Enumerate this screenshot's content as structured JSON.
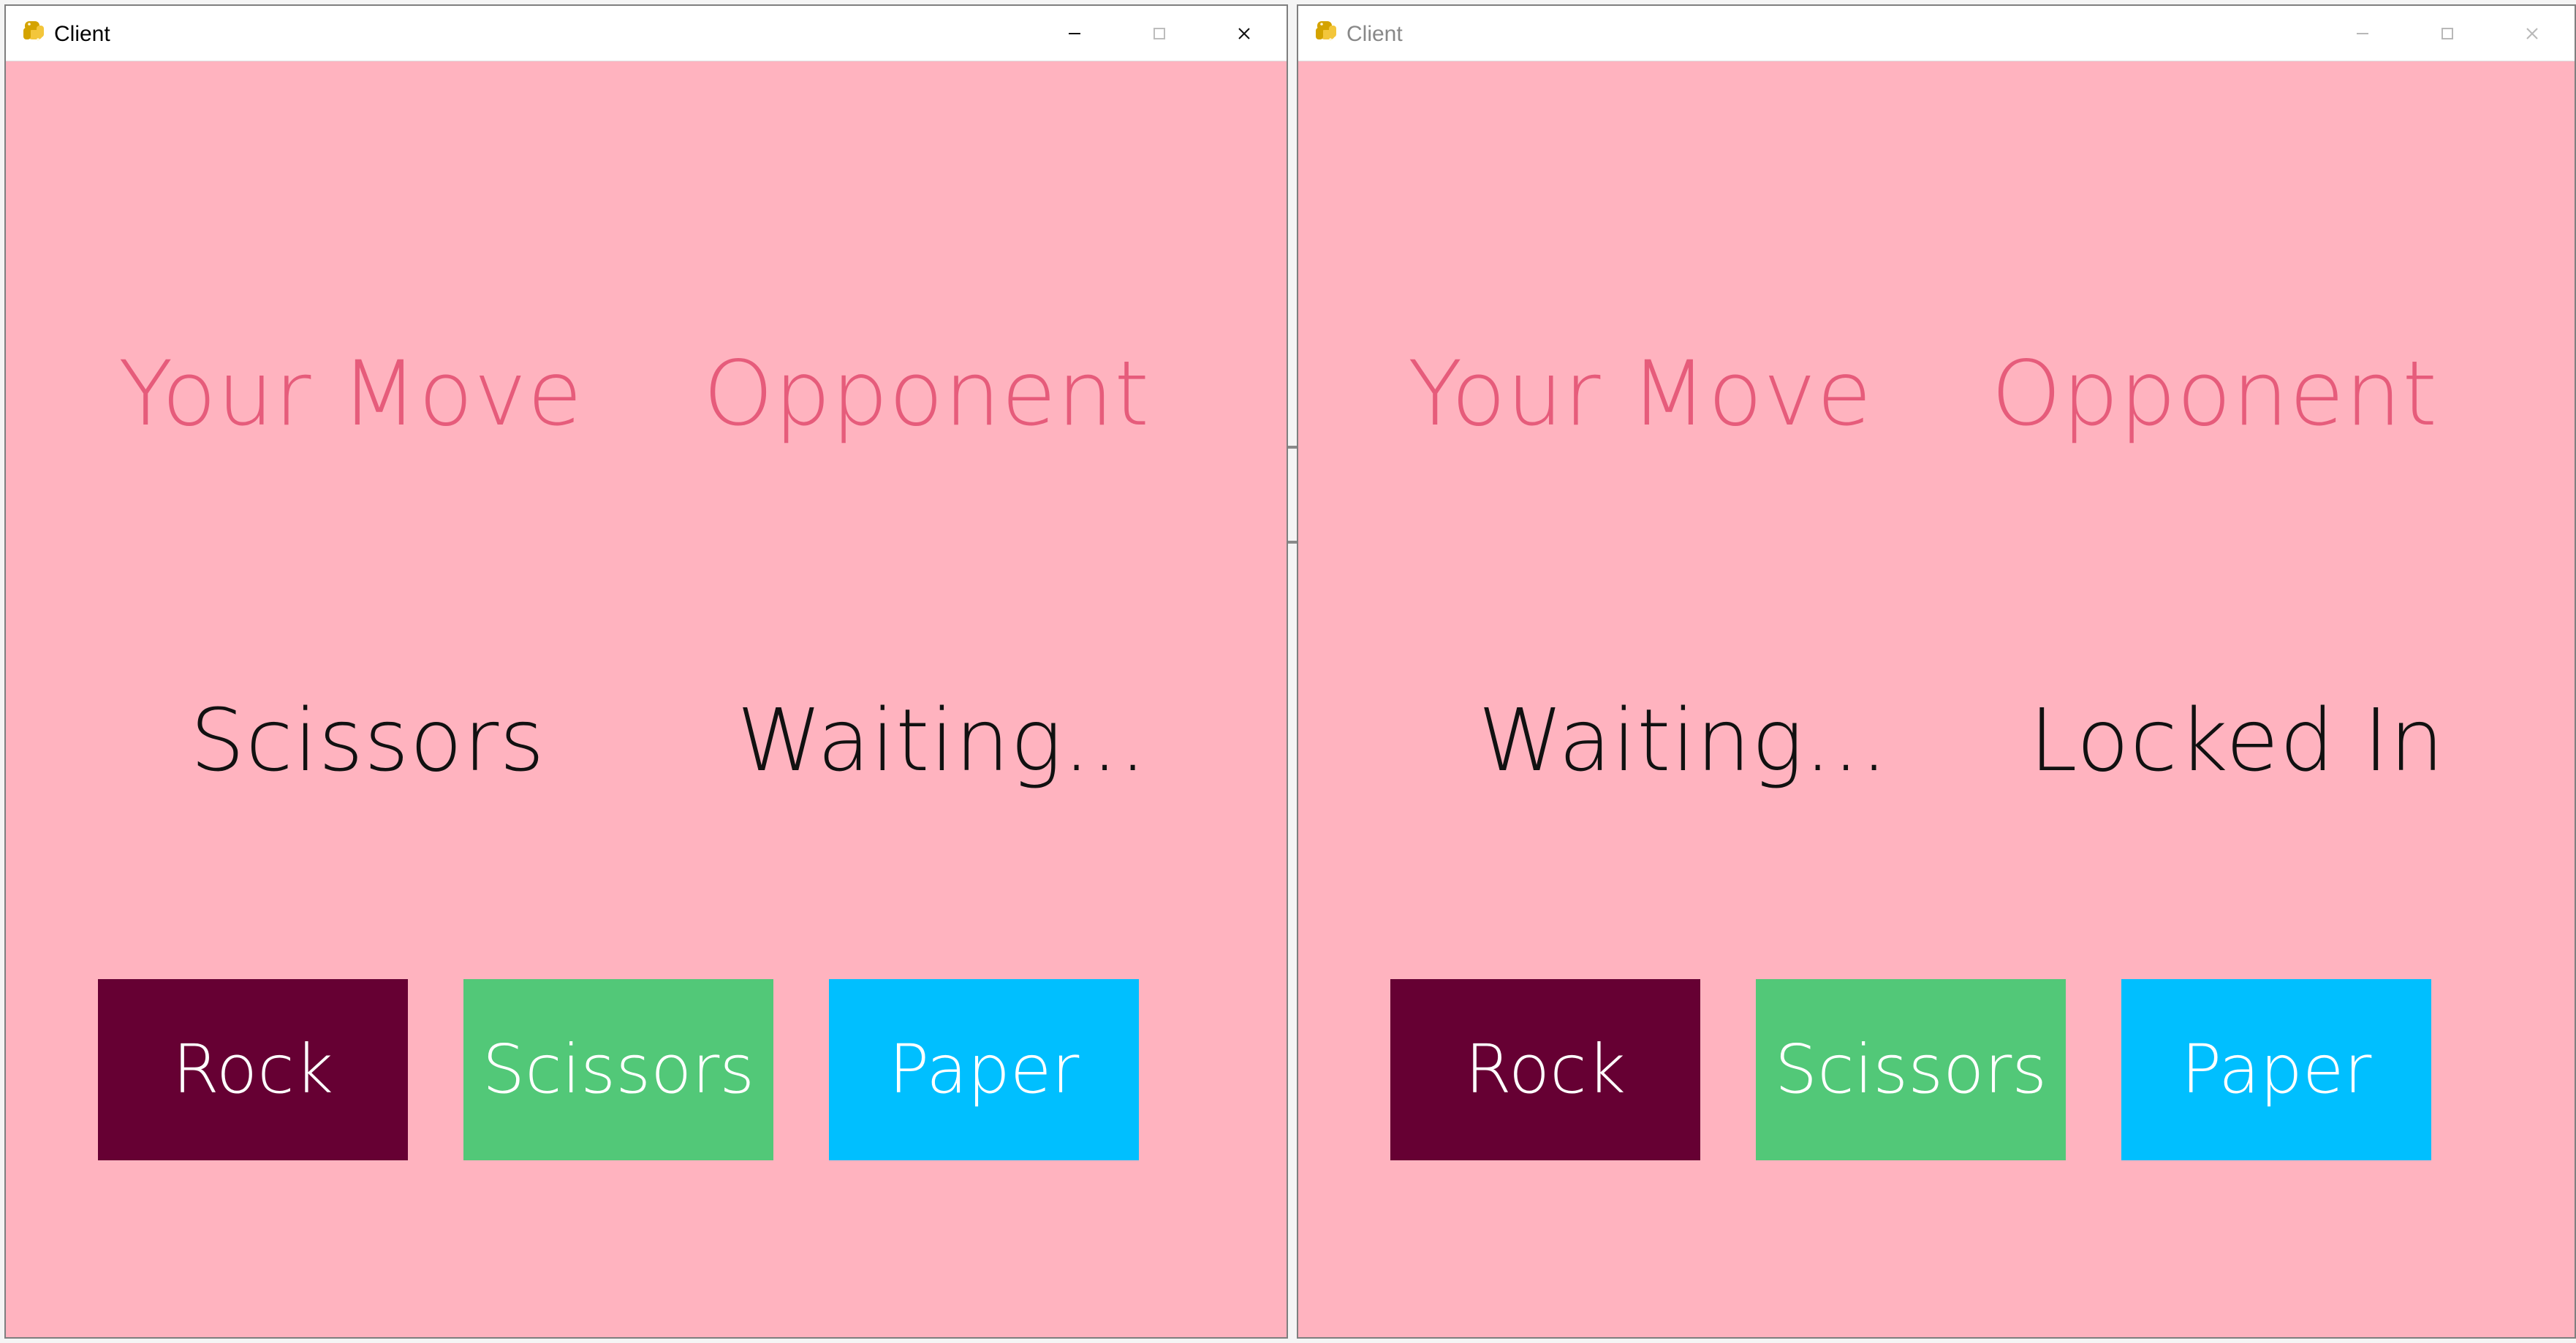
{
  "windows": [
    {
      "title": "Client",
      "headings": {
        "your_move": "Your Move",
        "opponent": "Opponent"
      },
      "statuses": {
        "your_move": "Scissors",
        "opponent": "Waiting..."
      },
      "buttons": [
        {
          "label": "Rock",
          "color": "#660033"
        },
        {
          "label": "Scissors",
          "color": "#52c878"
        },
        {
          "label": "Paper",
          "color": "#00bfff"
        }
      ]
    },
    {
      "title": "Client",
      "headings": {
        "your_move": "Your Move",
        "opponent": "Opponent"
      },
      "statuses": {
        "your_move": "Waiting...",
        "opponent": "Locked In"
      },
      "buttons": [
        {
          "label": "Rock",
          "color": "#660033"
        },
        {
          "label": "Scissors",
          "color": "#52c878"
        },
        {
          "label": "Paper",
          "color": "#00bfff"
        }
      ]
    }
  ],
  "theme": {
    "background": "#ffb3bf",
    "heading": "#e65c7b",
    "status": "#111111"
  },
  "icons": {
    "app": "python-icon",
    "minimize": "minimize-icon",
    "maximize": "maximize-icon",
    "close": "close-icon"
  }
}
